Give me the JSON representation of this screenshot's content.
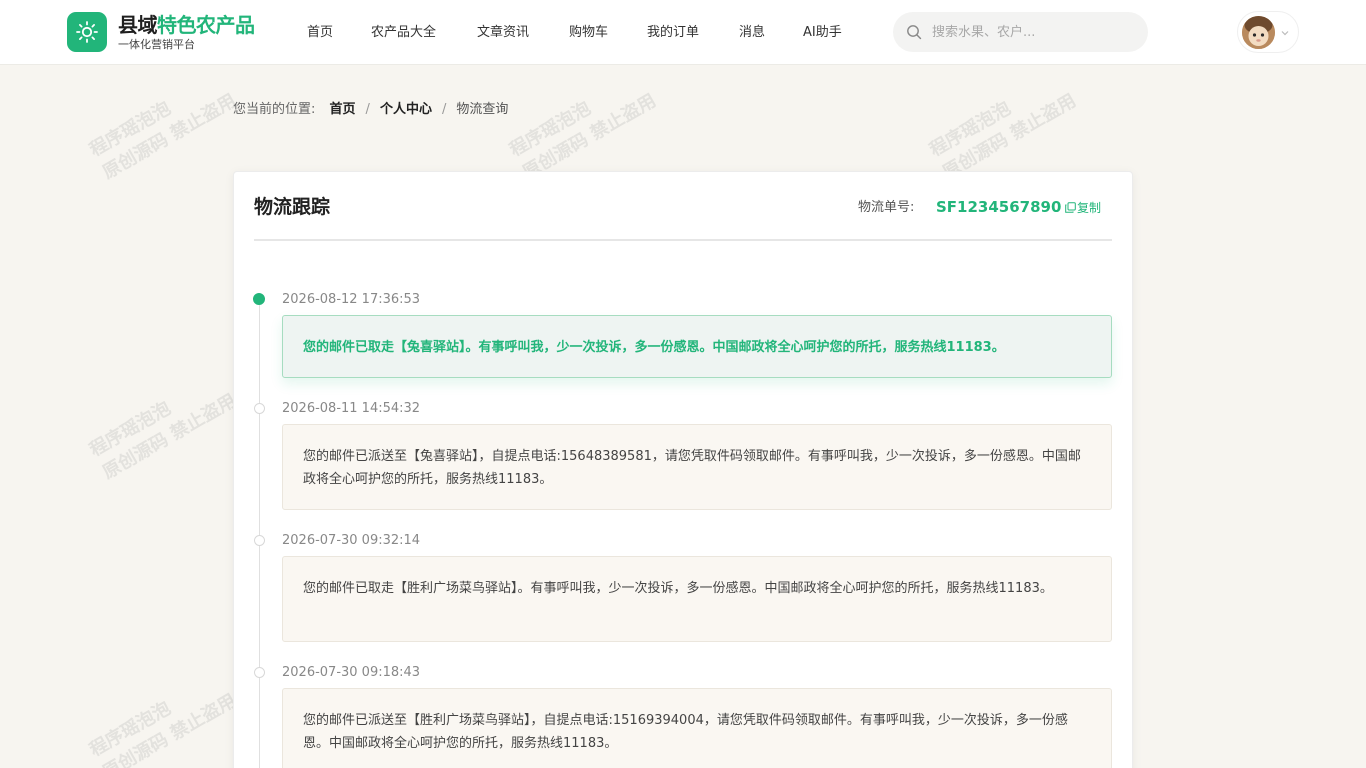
{
  "brand": {
    "title_part1": "县域",
    "title_part2": "特色农产品",
    "subtitle": "一体化营销平台"
  },
  "nav": [
    {
      "label": "首页"
    },
    {
      "label": "农产品大全"
    },
    {
      "label": "文章资讯"
    },
    {
      "label": "购物车"
    },
    {
      "label": "我的订单"
    },
    {
      "label": "消息"
    },
    {
      "label": "AI助手"
    }
  ],
  "search": {
    "placeholder": "搜索水果、农户..."
  },
  "watermark": {
    "line1": "程序瑶泡泡",
    "line2": "原创源码 禁止盗用"
  },
  "breadcrumb": {
    "prefix": "您当前的位置:",
    "items": [
      "首页",
      "个人中心",
      "物流查询"
    ],
    "separator": "/"
  },
  "tracking": {
    "title": "物流跟踪",
    "number_label": "物流单号:",
    "number": "SF1234567890",
    "copy_label": "复制"
  },
  "timeline": [
    {
      "time": "2026-08-12 17:36:53",
      "message": "您的邮件已取走【兔喜驿站】。有事呼叫我，少一次投诉，多一份感恩。中国邮政将全心呵护您的所托，服务热线11183。",
      "active": true
    },
    {
      "time": "2026-08-11 14:54:32",
      "message": "您的邮件已派送至【兔喜驿站】，自提点电话:15648389581，请您凭取件码领取邮件。有事呼叫我，少一次投诉，多一份感恩。中国邮政将全心呵护您的所托，服务热线11183。",
      "active": false
    },
    {
      "time": "2026-07-30 09:32:14",
      "message": "您的邮件已取走【胜利广场菜鸟驿站】。有事呼叫我，少一次投诉，多一份感恩。中国邮政将全心呵护您的所托，服务热线11183。",
      "active": false
    },
    {
      "time": "2026-07-30 09:18:43",
      "message": "您的邮件已派送至【胜利广场菜鸟驿站】，自提点电话:15169394004，请您凭取件码领取邮件。有事呼叫我，少一次投诉，多一份感恩。中国邮政将全心呵护您的所托，服务热线11183。",
      "active": false
    }
  ],
  "colors": {
    "accent": "#22b57a",
    "background": "#f7f5f0"
  }
}
